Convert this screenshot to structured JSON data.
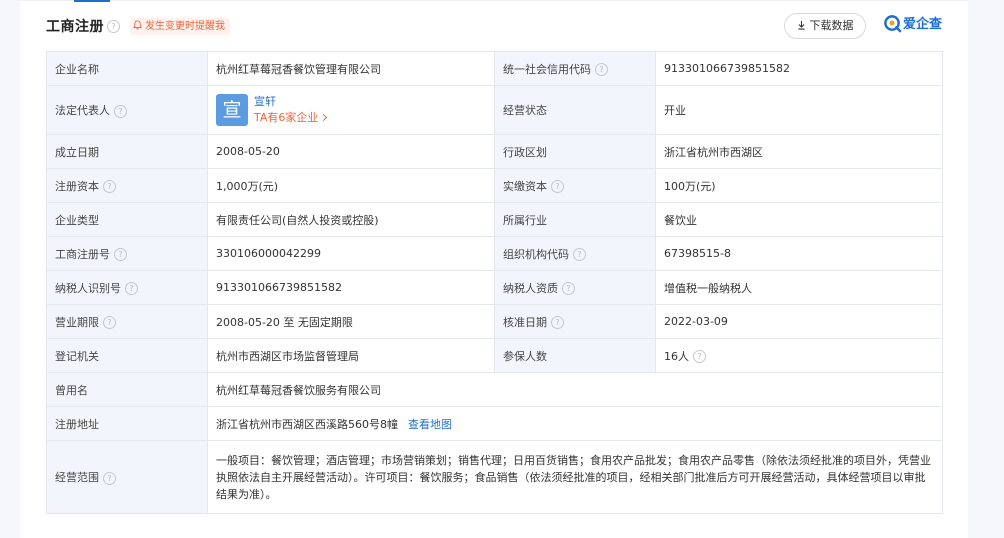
{
  "header": {
    "title": "工商注册",
    "notify_label": "发生变更时提醒我",
    "download_label": "下载数据",
    "brand_name": "爱企查"
  },
  "colors": {
    "accent": "#1f6fd1",
    "warning": "#f0653c",
    "label_bg": "#f2f6fc",
    "border": "#e4e7ec"
  },
  "icons": {
    "help": "question-circle-icon",
    "bell": "bell-icon",
    "download": "download-icon",
    "brand": "aiqicha-logo-icon",
    "chevron": "chevron-right-icon"
  },
  "company": {
    "name_label": "企业名称",
    "name": "杭州红草莓冠香餐饮管理有限公司",
    "credit_code_label": "统一社会信用代码",
    "credit_code": "913301066739851582",
    "legal_rep_label": "法定代表人",
    "legal_rep_avatar": "宣",
    "legal_rep_name": "宣轩",
    "legal_rep_companies": "TA有6家企业",
    "status_label": "经营状态",
    "status": "开业",
    "founded_label": "成立日期",
    "founded": "2008-05-20",
    "district_label": "行政区划",
    "district": "浙江省杭州市西湖区",
    "reg_capital_label": "注册资本",
    "reg_capital": "1,000万(元)",
    "paid_capital_label": "实缴资本",
    "paid_capital": "100万(元)",
    "type_label": "企业类型",
    "type": "有限责任公司(自然人投资或控股)",
    "industry_label": "所属行业",
    "industry": "餐饮业",
    "reg_no_label": "工商注册号",
    "reg_no": "330106000042299",
    "org_code_label": "组织机构代码",
    "org_code": "67398515-8",
    "taxpayer_id_label": "纳税人识别号",
    "taxpayer_id": "913301066739851582",
    "taxpayer_qual_label": "纳税人资质",
    "taxpayer_qual": "增值税一般纳税人",
    "term_label": "营业期限",
    "term": "2008-05-20 至 无固定期限",
    "approval_date_label": "核准日期",
    "approval_date": "2022-03-09",
    "authority_label": "登记机关",
    "authority": "杭州市西湖区市场监督管理局",
    "insured_label": "参保人数",
    "insured": "16人",
    "former_name_label": "曾用名",
    "former_name": "杭州红草莓冠香餐饮服务有限公司",
    "address_label": "注册地址",
    "address": "浙江省杭州市西湖区西溪路560号8幢",
    "map_link": "查看地图",
    "scope_label": "经营范围",
    "scope": "一般项目：餐饮管理；酒店管理；市场营销策划；销售代理；日用百货销售；食用农产品批发；食用农产品零售（除依法须经批准的项目外，凭营业执照依法自主开展经营活动）。许可项目：餐饮服务；食品销售（依法须经批准的项目，经相关部门批准后方可开展经营活动，具体经营项目以审批结果为准）。"
  }
}
